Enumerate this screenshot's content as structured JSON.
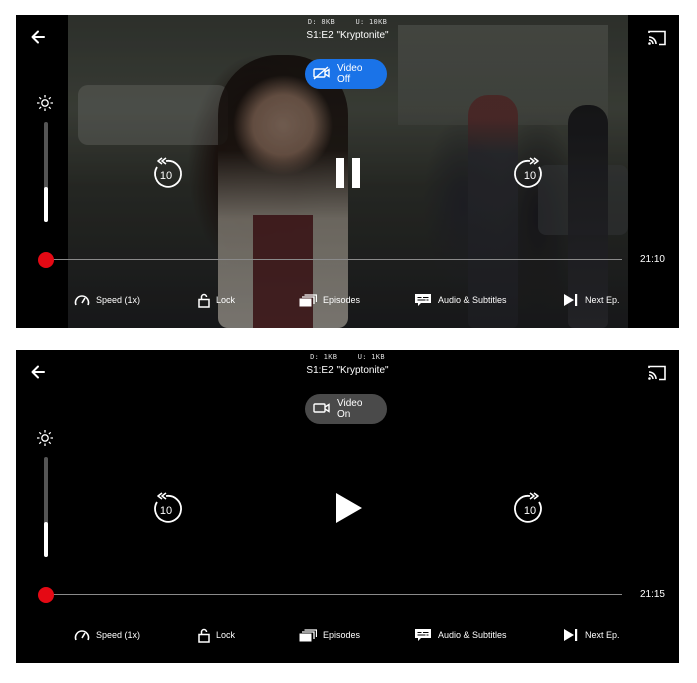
{
  "players": [
    {
      "state": "playing",
      "net": {
        "download": "D: 8KB",
        "upload": "U: 10KB"
      },
      "title": "S1:E2 \"Kryptonite\"",
      "video_toggle": {
        "label": "Video Off",
        "color": "#1a73e8"
      },
      "brightness_level": 0.35,
      "time_remaining": "21:10",
      "rewind_seconds": "10",
      "forward_seconds": "10",
      "controls": {
        "speed": "Speed (1x)",
        "lock": "Lock",
        "episodes": "Episodes",
        "audio_subtitles": "Audio & Subtitles",
        "next_episode": "Next Ep."
      },
      "accent_color": "#e50914"
    },
    {
      "state": "paused",
      "net": {
        "download": "D: 1KB",
        "upload": "U: 1KB"
      },
      "title": "S1:E2 \"Kryptonite\"",
      "video_toggle": {
        "label": "Video On",
        "color": "#4a4a4a"
      },
      "brightness_level": 0.35,
      "time_remaining": "21:15",
      "rewind_seconds": "10",
      "forward_seconds": "10",
      "controls": {
        "speed": "Speed (1x)",
        "lock": "Lock",
        "episodes": "Episodes",
        "audio_subtitles": "Audio & Subtitles",
        "next_episode": "Next Ep."
      },
      "accent_color": "#e50914"
    }
  ]
}
